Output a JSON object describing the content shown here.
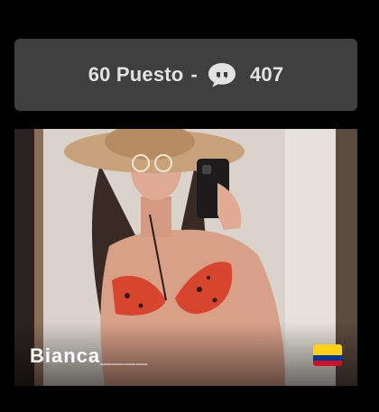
{
  "rank": {
    "position_text": "60 Puesto",
    "separator": "-",
    "comment_count": "407",
    "icon": "comment-bubble-icon"
  },
  "card": {
    "username": "Bianca____",
    "flag_icon": "colombia-flag-icon",
    "flag_colors": [
      "#FCD116",
      "#003893",
      "#CE1126"
    ]
  },
  "colors": {
    "background": "#000000",
    "bar_background": "#3f3f3f",
    "bar_text": "#e3e3e3"
  }
}
